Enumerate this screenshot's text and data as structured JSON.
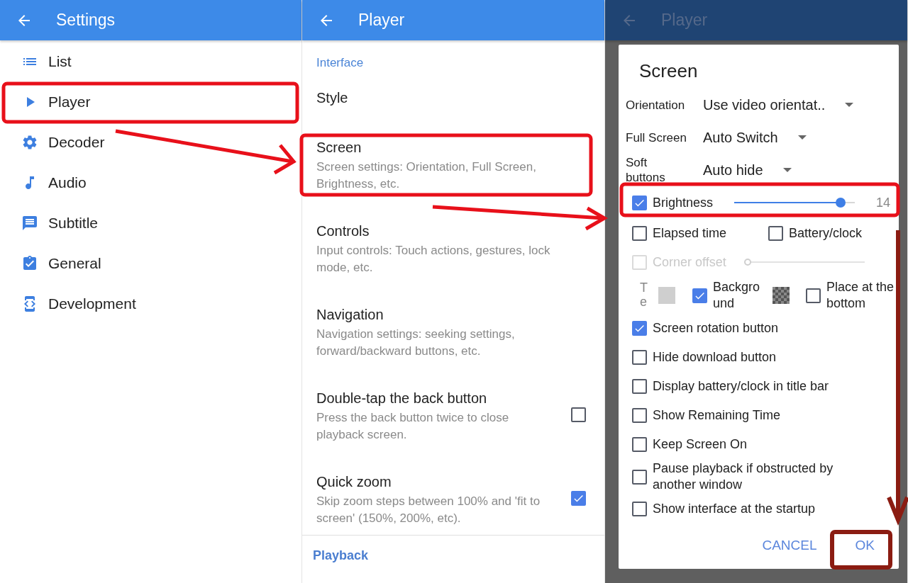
{
  "settings_screen": {
    "title": "Settings",
    "items": [
      {
        "label": "List"
      },
      {
        "label": "Player"
      },
      {
        "label": "Decoder"
      },
      {
        "label": "Audio"
      },
      {
        "label": "Subtitle"
      },
      {
        "label": "General"
      },
      {
        "label": "Development"
      }
    ]
  },
  "player_screen": {
    "title": "Player",
    "section": "Interface",
    "items": [
      {
        "title": "Style"
      },
      {
        "title": "Screen",
        "summary": "Screen settings: Orientation, Full Screen, Brightness, etc."
      },
      {
        "title": "Controls",
        "summary": "Input controls: Touch actions, gestures, lock mode, etc."
      },
      {
        "title": "Navigation",
        "summary": "Navigation settings: seeking settings, forward/backward buttons, etc."
      },
      {
        "title": "Double-tap the back button",
        "summary": "Press the back button twice to close playback screen.",
        "checked": false
      },
      {
        "title": "Quick zoom",
        "summary": "Skip zoom steps between 100% and 'fit to screen' (150%, 200%, etc).",
        "checked": true
      }
    ],
    "next_section": "Playback"
  },
  "screen_dialog": {
    "background_title": "Player",
    "title": "Screen",
    "dropdowns": [
      {
        "label": "Orientation",
        "value": "Use video orientat.."
      },
      {
        "label": "Full Screen",
        "value": "Auto Switch"
      },
      {
        "label": "Soft buttons",
        "value": "Auto hide"
      }
    ],
    "brightness": {
      "label": "Brightness",
      "checked": true,
      "level": 0.88,
      "reading": "14"
    },
    "pair": [
      {
        "label": "Elapsed time",
        "checked": false
      },
      {
        "label": "Battery/clock",
        "checked": false
      }
    ],
    "corner_offset": {
      "label": "Corner offset",
      "checked": false,
      "disabled": true,
      "level": 0
    },
    "colors": {
      "text_label": "Te",
      "background_label": "Background",
      "background_checked": true,
      "place_label": "Place at the bottom",
      "place_checked": false
    },
    "options": [
      {
        "label": "Screen rotation button",
        "checked": true
      },
      {
        "label": "Hide download button",
        "checked": false
      },
      {
        "label": "Display battery/clock in title bar",
        "checked": false
      },
      {
        "label": "Show Remaining Time",
        "checked": false
      },
      {
        "label": "Keep Screen On",
        "checked": false
      },
      {
        "label": "Pause playback if obstructed by another window",
        "checked": false
      },
      {
        "label": "Show interface at the startup",
        "checked": false
      }
    ],
    "buttons": [
      "CANCEL",
      "OK"
    ]
  }
}
